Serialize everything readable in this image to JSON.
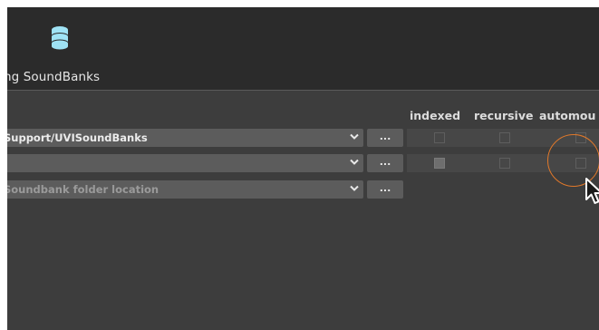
{
  "header": {
    "icon": "database-icon",
    "title": "ng SoundBanks"
  },
  "columns": {
    "indexed": "indexed",
    "recursive": "recursive",
    "automount": "automou"
  },
  "rows": [
    {
      "path": "Support/UVISoundBanks",
      "is_placeholder": false,
      "browse_label": "...",
      "indexed": false,
      "recursive": false,
      "automount": false
    },
    {
      "path": "",
      "is_placeholder": false,
      "browse_label": "...",
      "indexed": true,
      "recursive": false,
      "automount": false
    },
    {
      "path": "Soundbank folder location",
      "is_placeholder": true,
      "browse_label": "..."
    }
  ],
  "colors": {
    "accent_ring": "#e0782a",
    "icon_cyan": "#9fe3f5"
  }
}
